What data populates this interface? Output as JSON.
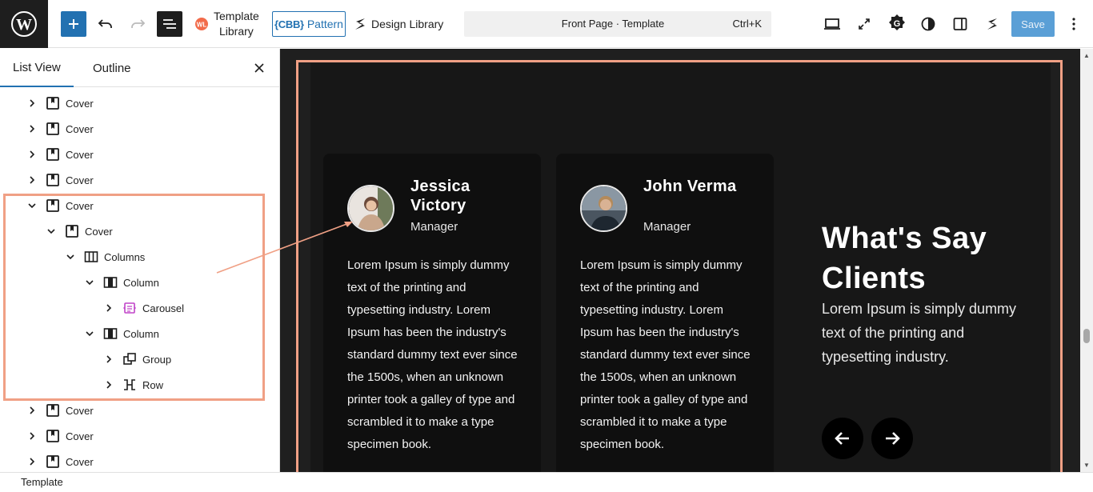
{
  "toolbar": {
    "template_library_label_line1": "Template",
    "template_library_label_line2": "Library",
    "pattern_cbb": "{CBB}",
    "pattern_label": "Pattern",
    "design_library_label": "Design Library",
    "command_title": "Front Page · Template",
    "command_shortcut": "Ctrl+K",
    "save_label": "Save"
  },
  "sidebar": {
    "tabs": [
      {
        "label": "List View",
        "active": true
      },
      {
        "label": "Outline",
        "active": false
      }
    ],
    "tree": [
      {
        "label": "Cover",
        "icon": "cover-icon",
        "expanded": false
      },
      {
        "label": "Cover",
        "icon": "cover-icon",
        "expanded": false
      },
      {
        "label": "Cover",
        "icon": "cover-icon",
        "expanded": false
      },
      {
        "label": "Cover",
        "icon": "cover-icon",
        "expanded": false
      },
      {
        "label": "Cover",
        "icon": "cover-icon",
        "expanded": true
      },
      {
        "label": "Cover",
        "icon": "cover-icon",
        "expanded": true
      },
      {
        "label": "Columns",
        "icon": "columns-icon",
        "expanded": true
      },
      {
        "label": "Column",
        "icon": "column-icon",
        "expanded": true
      },
      {
        "label": "Carousel",
        "icon": "carousel-icon",
        "expanded": false
      },
      {
        "label": "Column",
        "icon": "column-icon",
        "expanded": true
      },
      {
        "label": "Group",
        "icon": "group-icon",
        "expanded": false
      },
      {
        "label": "Row",
        "icon": "row-icon",
        "expanded": false
      },
      {
        "label": "Cover",
        "icon": "cover-icon",
        "expanded": false
      },
      {
        "label": "Cover",
        "icon": "cover-icon",
        "expanded": false
      },
      {
        "label": "Cover",
        "icon": "cover-icon",
        "expanded": false
      }
    ]
  },
  "statusbar": {
    "breadcrumb": "Template"
  },
  "canvas": {
    "testimonials": [
      {
        "name": "Jessica Victory",
        "role": "Manager",
        "quote": "Lorem Ipsum is simply dummy text of the printing and typesetting industry. Lorem Ipsum has been the industry's standard dummy text ever since the 1500s, when an unknown printer took a galley of type and scrambled it to make a type specimen book."
      },
      {
        "name": "John Verma",
        "role": "Manager",
        "quote": "Lorem Ipsum is simply dummy text of the printing and typesetting industry. Lorem Ipsum has been the industry's standard dummy text ever since the 1500s, when an unknown printer took a galley of type and scrambled it to make a type specimen book."
      }
    ],
    "heading": "What's Say Clients",
    "subtext": "Lorem Ipsum is simply dummy text of the printing and typesetting industry."
  },
  "colors": {
    "accent": "#2271b1",
    "highlight": "#f0a085",
    "canvas_bg": "#1f1f1f",
    "card_bg": "#0f0f0f"
  }
}
